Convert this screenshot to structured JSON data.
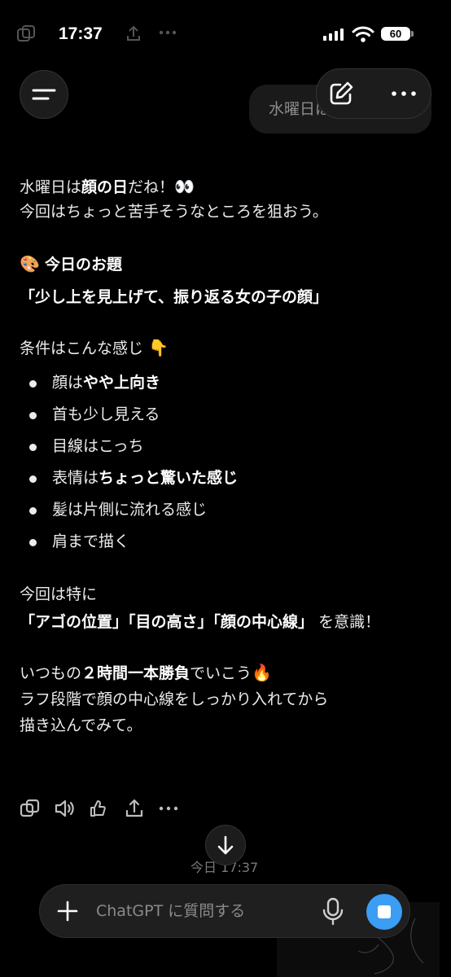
{
  "status_bar": {
    "time": "17:37",
    "battery": "60"
  },
  "user_message": {
    "preview": "水曜日は顔の日だね"
  },
  "assistant": {
    "line1_a": "水曜日は",
    "line1_b": "顔の日",
    "line1_c": "だね！",
    "line1_emoji": "👀",
    "line2": "今回はちょっと苦手そうなところを狙おう。",
    "theme_emoji": "🎨",
    "theme_heading": "今日のお題",
    "theme": "「少し上を見上げて、振り返る女の子の顔」",
    "conditions_intro": "条件はこんな感じ",
    "conditions_emoji": "👇",
    "bullets": [
      {
        "plain": "顔は",
        "bold": "やや上向き"
      },
      {
        "plain": "首も少し見える",
        "bold": ""
      },
      {
        "plain": "目線はこっち",
        "bold": ""
      },
      {
        "plain": "表情は",
        "bold": "ちょっと驚いた感じ"
      },
      {
        "plain": "髪は片側に流れる感じ",
        "bold": ""
      },
      {
        "plain": "肩まで描く",
        "bold": ""
      }
    ],
    "focus_intro": "今回は特に",
    "focus_1": "「アゴの位置」",
    "focus_2": "「目の高さ」",
    "focus_3": "「顔の中心線」",
    "focus_tail": "を意識！",
    "closing_a": "いつもの",
    "closing_b": "２時間一本勝負",
    "closing_c": "でいこう",
    "closing_emoji": "🔥",
    "closing_2": "ラフ段階で顔の中心線をしっかり入れてから",
    "closing_3": "描き込んでみて。"
  },
  "timestamp": "今日 17:37",
  "composer": {
    "placeholder": "ChatGPT に質問する"
  },
  "colors": {
    "send": "#3b9df3",
    "background": "#000000"
  }
}
